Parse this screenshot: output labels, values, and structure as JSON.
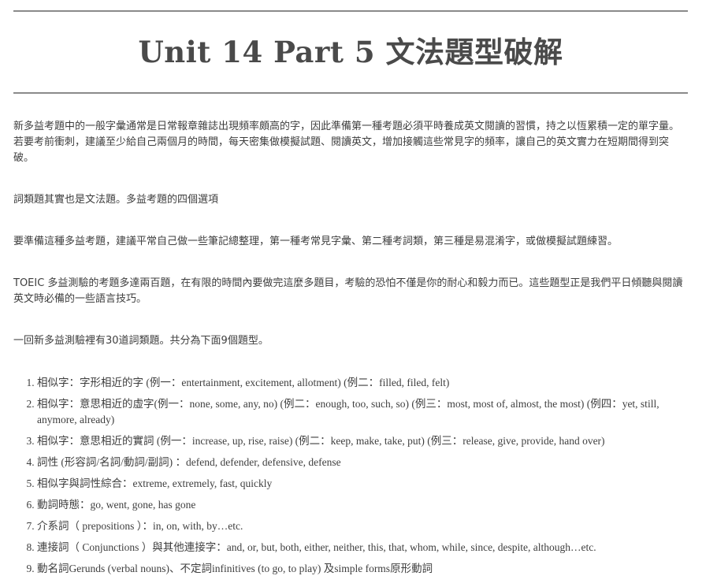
{
  "header": {
    "title": "Unit 14 Part 5 文法題型破解"
  },
  "paragraphs": [
    "新多益考題中的一般字彙通常是日常報章雜誌出現頻率頗高的字，因此準備第一種考題必須平時養成英文閱讀的習慣，持之以恆累積一定的單字量。若要考前衝刺，建議至少給自己兩個月的時間，每天密集做模擬試題、閱讀英文，增加接觸這些常見字的頻率，讓自己的英文實力在短期間得到突破。",
    "詞類題其實也是文法題。多益考題的四個選項",
    "要準備這種多益考題，建議平常自己做一些筆記總整理，第一種考常見字彙、第二種考詞類，第三種是易混淆字，或做模擬試題練習。",
    "TOEIC 多益測驗的考題多達兩百題，在有限的時間內要做完這麼多題目，考驗的恐怕不僅是你的耐心和毅力而已。這些題型正是我們平日傾聽與閱讀英文時必備的一些語言技巧。",
    "一回新多益測驗裡有30道詞類題。共分為下面9個題型。"
  ],
  "list_items": [
    "相似字：字形相近的字 (例一：entertainment, excitement, allotment) (例二：filled, filed, felt)",
    "相似字：意思相近的虛字(例一：none, some, any, no) (例二：enough, too, such, so) (例三：most, most of, almost, the most) (例四：yet, still, anymore, already)",
    "相似字：意思相近的實詞 (例一：increase, up, rise, raise) (例二：keep, make, take, put) (例三：release, give, provide, hand over)",
    "詞性 (形容詞/名詞/動詞/副詞) ：defend, defender, defensive, defense",
    "相似字與詞性綜合：extreme, extremely, fast, quickly",
    "動詞時態：go, went, gone, has gone",
    "介系詞（ prepositions ）：in, on, with, by…etc.",
    "連接詞（ Conjunctions ）與其他連接字：and, or, but, both, either, neither, this, that, whom, while, since, despite, although…etc.",
    "動名詞Gerunds (verbal nouns)、不定詞infinitives (to go, to play) 及simple forms原形動詞"
  ]
}
